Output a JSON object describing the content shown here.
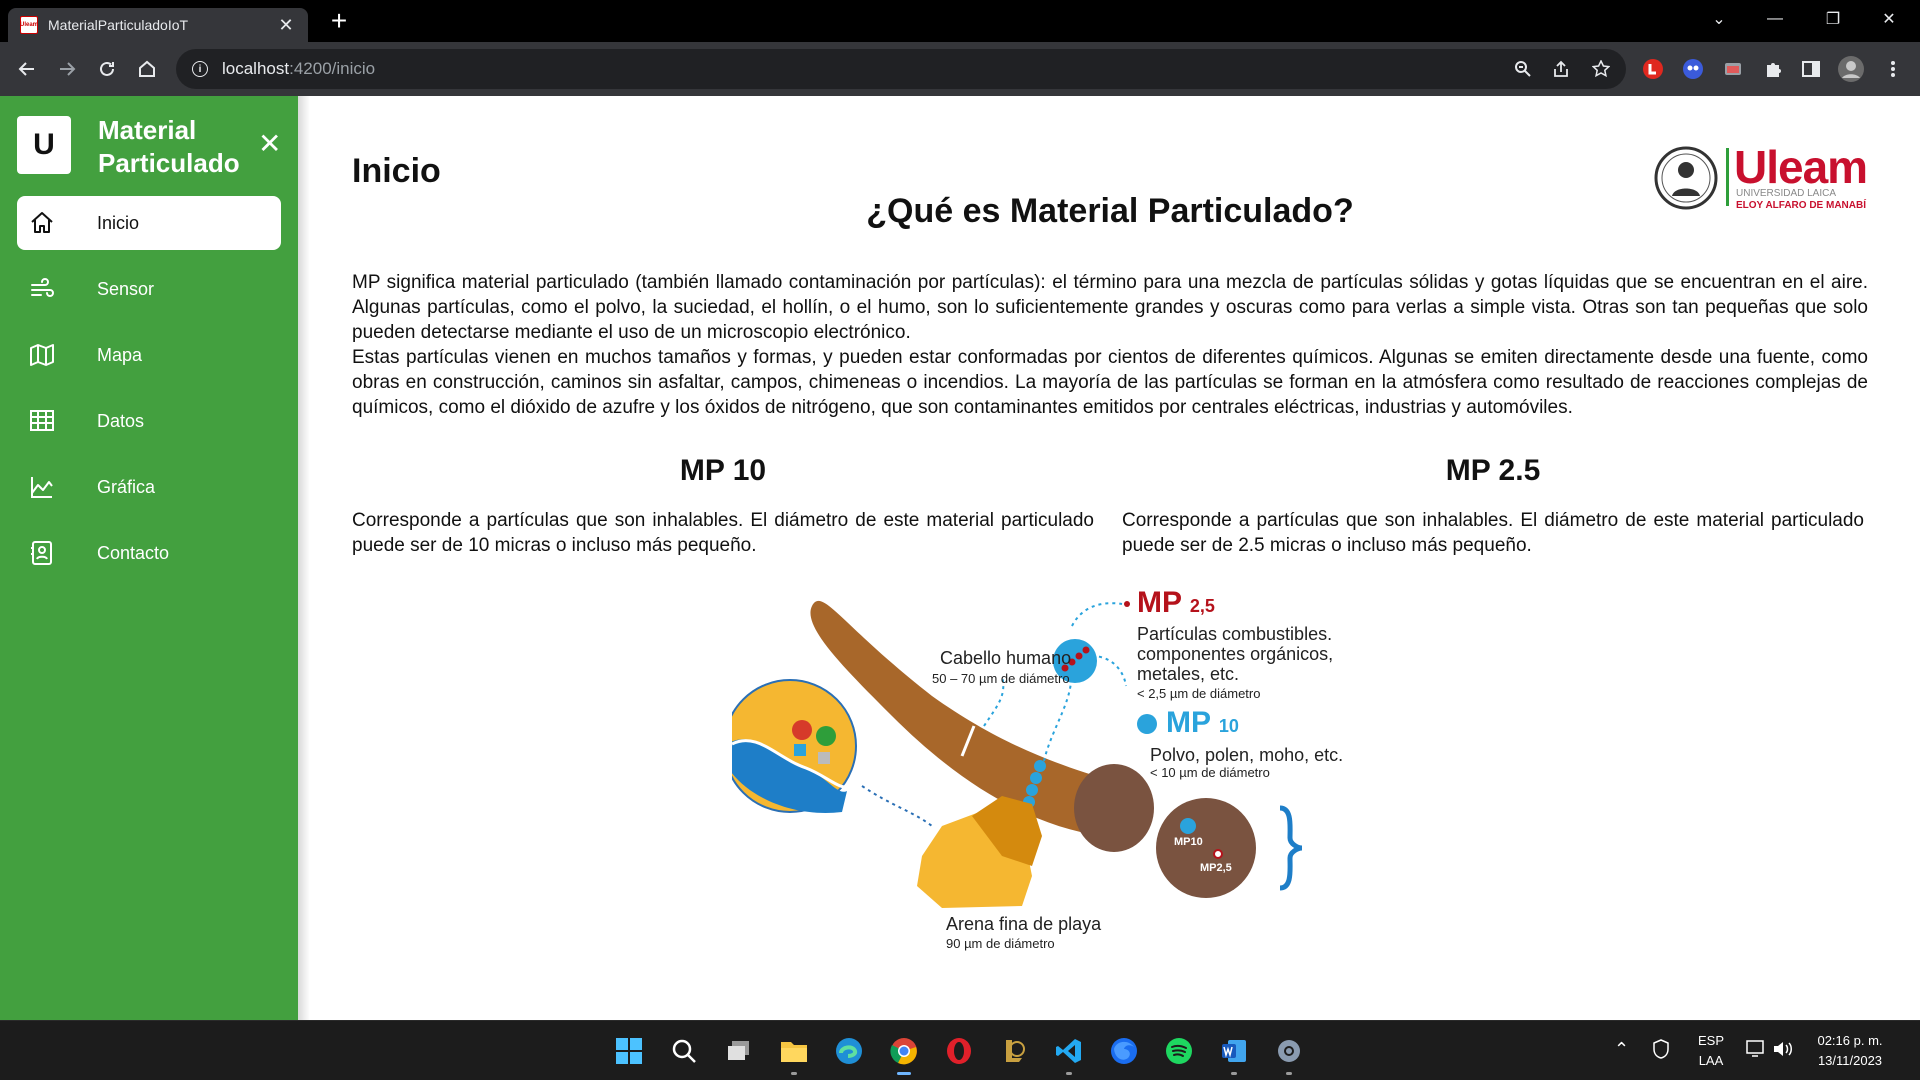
{
  "browser": {
    "tab_title": "MaterialParticuladoIoT",
    "favicon_text": "Uleam",
    "url_host": "localhost",
    "url_path": ":4200/inicio"
  },
  "sidebar": {
    "brand_letter": "U",
    "brand_name": "Material Particulado",
    "items": [
      {
        "label": "Inicio",
        "icon": "home-icon",
        "active": true
      },
      {
        "label": "Sensor",
        "icon": "wind-icon",
        "active": false
      },
      {
        "label": "Mapa",
        "icon": "map-icon",
        "active": false
      },
      {
        "label": "Datos",
        "icon": "table-icon",
        "active": false
      },
      {
        "label": "Gráfica",
        "icon": "chart-icon",
        "active": false
      },
      {
        "label": "Contacto",
        "icon": "contact-icon",
        "active": false
      }
    ]
  },
  "main": {
    "page_title": "Inicio",
    "heading": "¿Qué es Material Particulado?",
    "intro_p1": "MP significa material particulado (también llamado contaminación por partículas): el término para una mezcla de partículas sólidas y gotas líquidas que se encuentran en el aire. Algunas partículas, como el polvo, la suciedad, el hollín, o el humo, son lo suficientemente grandes y oscuras como para verlas a simple vista. Otras son tan pequeñas que solo pueden detectarse mediante el uso de un microscopio electrónico.",
    "intro_p2": "Estas partículas vienen en muchos tamaños y formas, y pueden estar conformadas por cientos de diferentes químicos. Algunas se emiten directamente desde una fuente, como obras en construcción, caminos sin asfaltar, campos, chimeneas o incendios. La mayoría de las partículas se forman en la atmósfera como resultado de reacciones complejas de químicos, como el dióxido de azufre y los óxidos de nitrógeno, que son contaminantes emitidos por centrales eléctricas, industrias y automóviles.",
    "mp10": {
      "title": "MP 10",
      "text": "Corresponde a partículas que son inhalables. El diámetro de este material particulado puede ser de 10 micras o incluso más pequeño."
    },
    "mp25": {
      "title": "MP 2.5",
      "text": "Corresponde a partículas que son inhalables. El diámetro de este material particulado puede ser de 2.5 micras o incluso más pequeño."
    }
  },
  "logo": {
    "name": "Uleam",
    "line1": "UNIVERSIDAD LAICA",
    "line2": "ELOY ALFARO DE MANABÍ"
  },
  "infographic": {
    "hair_label": "Cabello humano",
    "hair_size": "50 – 70 µm de diámetro",
    "mp25_title": "MP",
    "mp25_sub": "2,5",
    "mp25_desc1": "Partículas combustibles.",
    "mp25_desc2": "componentes orgánicos,",
    "mp25_desc3": "metales, etc.",
    "mp25_size": "< 2,5 µm de diámetro",
    "mp10_title": "MP",
    "mp10_sub": "10",
    "mp10_desc": "Polvo, polen, moho, etc.",
    "mp10_size": "< 10 µm de diámetro",
    "sand_label": "Arena fina de playa",
    "sand_size": "90 µm de diámetro",
    "circle_mp10": "MP10",
    "circle_mp25": "MP2,5"
  },
  "taskbar": {
    "lang1": "ESP",
    "lang2": "LAA",
    "time": "02:16 p. m.",
    "date": "13/11/2023"
  },
  "colors": {
    "sidebar_green": "#43a03f",
    "uleam_red": "#c8102e",
    "mp25_red": "#b5121b",
    "mp10_blue": "#2aa3dc",
    "hair_brown": "#a8672a"
  }
}
